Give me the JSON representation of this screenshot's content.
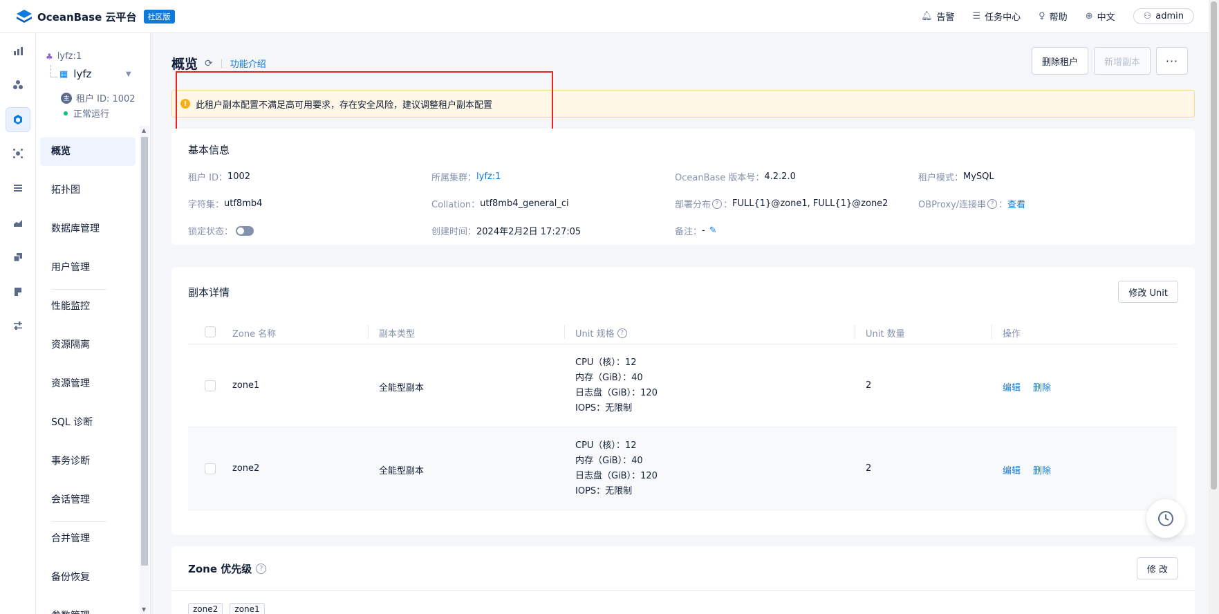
{
  "app": {
    "logo_text": "OceanBase 云平台",
    "edition_badge": "社区版",
    "brand_color": "#0e7adc"
  },
  "topbar": {
    "alarm": "告警",
    "tasks": "任务中心",
    "help": "帮助",
    "language": "中文",
    "user": "admin"
  },
  "rail": {
    "icons": [
      "bar-chart-icon",
      "cluster-icon",
      "tenant-icon",
      "cross-dot-icon",
      "list-icon",
      "area-chart-icon",
      "copy-icon",
      "document-icon",
      "sliders-icon"
    ],
    "active_index": 2
  },
  "tenant": {
    "cluster": "lyfz:1",
    "name": "lyfz",
    "id_text": "租户 ID: 1002",
    "id_badge": "主",
    "status": "正常运行",
    "status_color": "#0ac185"
  },
  "menu": {
    "items": [
      "概览",
      "拓扑图",
      "数据库管理",
      "用户管理",
      "性能监控",
      "资源隔离",
      "资源管理",
      "SQL 诊断",
      "事务诊断",
      "会话管理",
      "合并管理",
      "备份恢复",
      "参数管理"
    ],
    "active_index": 0
  },
  "page": {
    "title": "概览",
    "feature_intro": "功能介绍",
    "delete_tenant": "删除租户",
    "add_replica": "新增副本",
    "more": "···"
  },
  "alert": {
    "text": "此租户副本配置不满足高可用要求，存在安全风险，建议调整租户副本配置",
    "color": "#faad14"
  },
  "basic_info": {
    "title": "基本信息",
    "tenant_id_label": "租户 ID：",
    "tenant_id": "1002",
    "cluster_label": "所属集群：",
    "cluster": "lyfz:1",
    "version_label": "OceanBase 版本号：",
    "version": "4.2.2.0",
    "mode_label": "租户模式：",
    "mode": "MySQL",
    "charset_label": "字符集：",
    "charset": "utf8mb4",
    "collation_label": "Collation：",
    "collation": "utf8mb4_general_ci",
    "distribution_label": "部署分布",
    "distribution": "FULL{1}@zone1, FULL{1}@zone2",
    "obproxy_label": "OBProxy/连接串",
    "obproxy_link": "查看",
    "lock_label": "锁定状态：",
    "created_label": "创建时间：",
    "created": "2024年2月2日 17:27:05",
    "remark_label": "备注：",
    "remark": "-"
  },
  "replicas": {
    "title": "副本详情",
    "modify_unit": "修改 Unit",
    "columns": [
      "Zone 名称",
      "副本类型",
      "Unit 规格",
      "Unit 数量",
      "操作"
    ],
    "rows": [
      {
        "zone": "zone1",
        "type": "全能型副本",
        "spec": [
          "CPU（核）：12",
          "内存（GiB）：40",
          "日志盘（GiB）：120",
          "IOPS：无限制"
        ],
        "count": "2",
        "edit": "编辑",
        "delete": "删除"
      },
      {
        "zone": "zone2",
        "type": "全能型副本",
        "spec": [
          "CPU（核）：12",
          "内存（GiB）：40",
          "日志盘（GiB）：120",
          "IOPS：无限制"
        ],
        "count": "2",
        "edit": "编辑",
        "delete": "删除"
      }
    ]
  },
  "zone_priority": {
    "title": "Zone 优先级",
    "modify": "修 改",
    "tags": [
      "zone2",
      "zone1"
    ]
  }
}
